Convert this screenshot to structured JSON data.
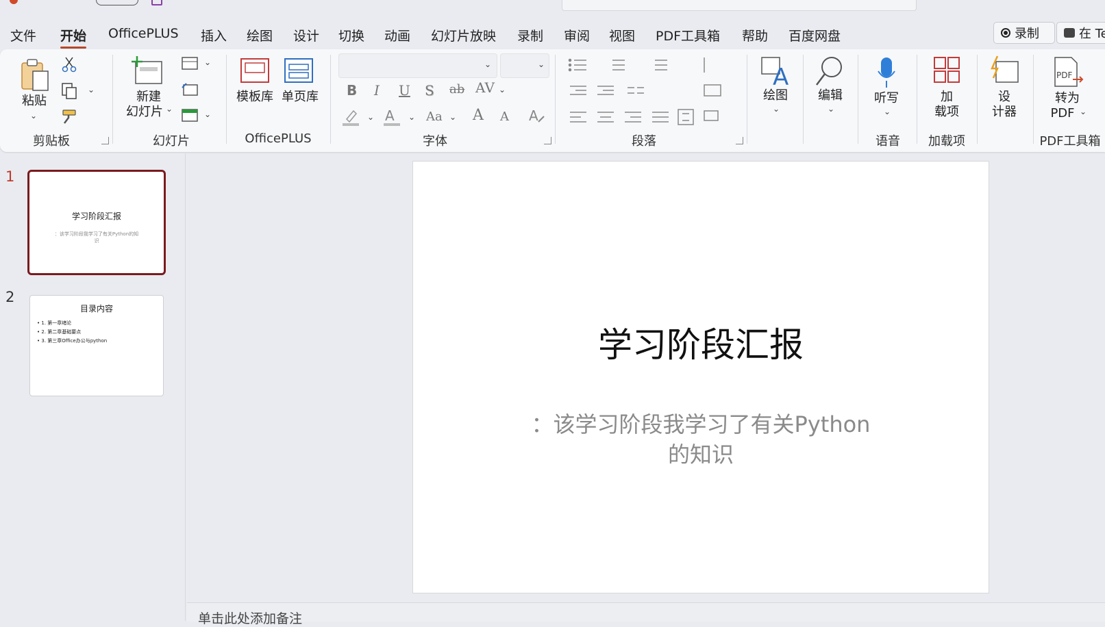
{
  "menu": {
    "tabs": [
      "文件",
      "开始",
      "OfficePLUS",
      "插入",
      "绘图",
      "设计",
      "切换",
      "动画",
      "幻灯片放映",
      "录制",
      "审阅",
      "视图",
      "PDF工具箱",
      "帮助",
      "百度网盘"
    ],
    "active_tab": "开始",
    "record_label": "录制",
    "teams_label": "在 Te"
  },
  "ribbon": {
    "paste": "粘贴",
    "new_slide_1": "新建",
    "new_slide_2": "幻灯片",
    "template_lib": "模板库",
    "page_lib": "单页库",
    "draw": "绘图",
    "edit": "编辑",
    "dictate": "听写",
    "addins_1": "加",
    "addins_2": "载项",
    "designer_1": "设",
    "designer_2": "计器",
    "to_pdf_1": "转为",
    "to_pdf_2": "PDF",
    "groups": {
      "clipboard": "剪贴板",
      "slides": "幻灯片",
      "officeplus": "OfficePLUS",
      "font": "字体",
      "paragraph": "段落",
      "voice": "语音",
      "addins": "加载项",
      "pdf": "PDF工具箱"
    },
    "font_buttons": {
      "bold": "B",
      "italic": "I",
      "underline": "U",
      "shadow": "S",
      "strike": "ab",
      "spacing": "AV",
      "case": "Aa",
      "grow": "A",
      "shrink": "A"
    }
  },
  "slides": [
    {
      "number": "1",
      "title": "学习阶段汇报",
      "subtitle": "：该学习阶段我学习了有关Python的知识",
      "selected": true
    },
    {
      "number": "2",
      "title": "目录内容",
      "bullets": [
        "1. 第一章绪论",
        "2. 第二章基础要点",
        "3. 第三章Office办公与python"
      ],
      "selected": false
    }
  ],
  "current_slide": {
    "title": "学习阶段汇报",
    "subtitle_line1": "：该学习阶段我学习了有关Python",
    "subtitle_line2": "的知识"
  },
  "notes_placeholder": "单击此处添加备注",
  "colors": {
    "accent": "#b7472a",
    "selected_border": "#7a1a1f",
    "ribbon_bg": "#f7f8fa",
    "app_bg": "#e9ebf0"
  }
}
